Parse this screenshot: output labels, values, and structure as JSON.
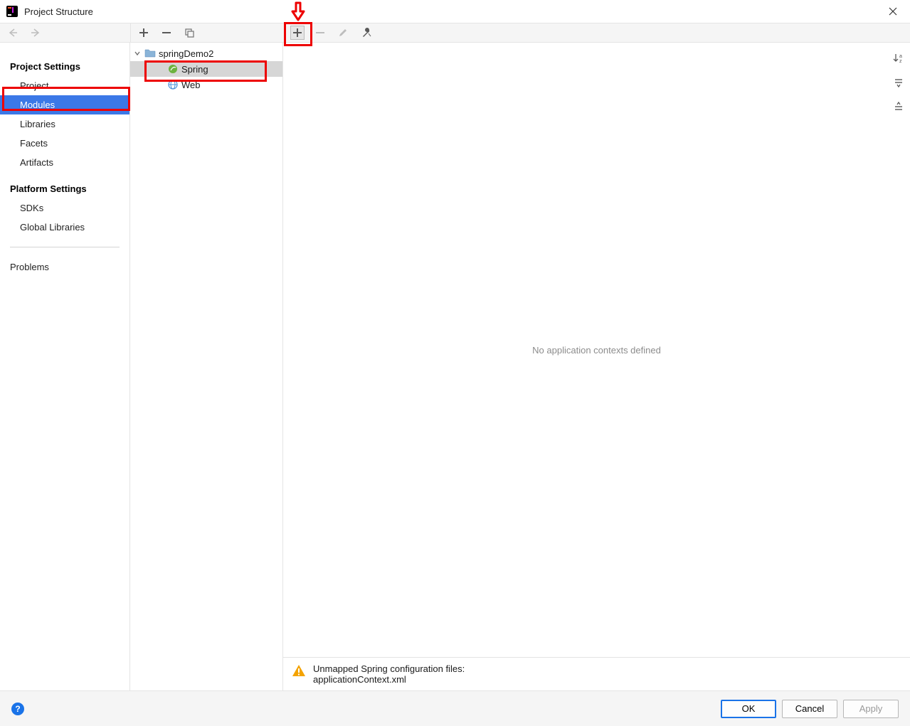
{
  "window": {
    "title": "Project Structure"
  },
  "sidebar": {
    "section1_title": "Project Settings",
    "section1_items": [
      "Project",
      "Modules",
      "Libraries",
      "Facets",
      "Artifacts"
    ],
    "section2_title": "Platform Settings",
    "section2_items": [
      "SDKs",
      "Global Libraries"
    ],
    "section3_items": [
      "Problems"
    ],
    "selected": "Modules"
  },
  "tree": {
    "root": {
      "label": "springDemo2"
    },
    "children": [
      {
        "label": "Spring",
        "icon": "spring",
        "selected": true
      },
      {
        "label": "Web",
        "icon": "web",
        "selected": false
      }
    ]
  },
  "content": {
    "empty_message": "No application contexts defined",
    "warning_line1": "Unmapped Spring configuration files:",
    "warning_line2": "applicationContext.xml"
  },
  "buttons": {
    "ok": "OK",
    "cancel": "Cancel",
    "apply": "Apply"
  }
}
